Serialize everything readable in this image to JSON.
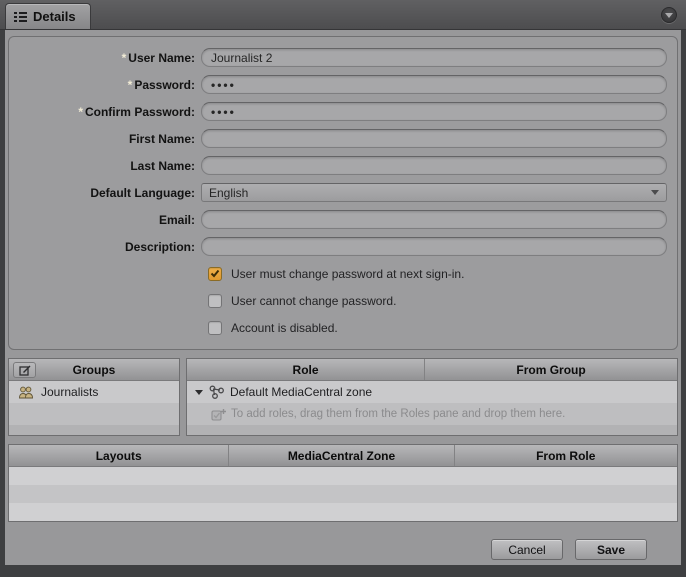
{
  "window": {
    "tab_label": "Details"
  },
  "form": {
    "fields": [
      {
        "marker": "*",
        "label": "User Name:",
        "value": "Journalist 2"
      },
      {
        "marker": "*",
        "label": "Password:",
        "value": "••••"
      },
      {
        "marker": "*",
        "label": "Confirm Password:",
        "value": "••••"
      },
      {
        "label": "First Name:",
        "value": ""
      },
      {
        "label": "Last Name:",
        "value": ""
      },
      {
        "label": "Default Language:",
        "value": "English"
      },
      {
        "label": "Email:",
        "value": ""
      },
      {
        "label": "Description:",
        "value": ""
      }
    ],
    "checkboxes": [
      {
        "label": "User must change password at next sign-in.",
        "checked": true
      },
      {
        "label": "User cannot change password.",
        "checked": false
      },
      {
        "label": "Account is disabled.",
        "checked": false
      }
    ]
  },
  "groups": {
    "title": "Groups",
    "items": [
      {
        "label": "Journalists"
      }
    ]
  },
  "roles": {
    "col_role": "Role",
    "col_from_group": "From Group",
    "rows": [
      {
        "role": "Default MediaCentral zone",
        "from_group": ""
      }
    ],
    "hint": "To add roles, drag them from the Roles pane and drop them here."
  },
  "layouts": {
    "col_layouts": "Layouts",
    "col_zone": "MediaCentral Zone",
    "col_from_role": "From Role"
  },
  "footer": {
    "cancel_label": "Cancel",
    "save_label": "Save"
  },
  "colors": {
    "checked_checkbox": "#eba73d",
    "group_icon": "#bfa878",
    "required_marker": "#f2ecd6"
  }
}
